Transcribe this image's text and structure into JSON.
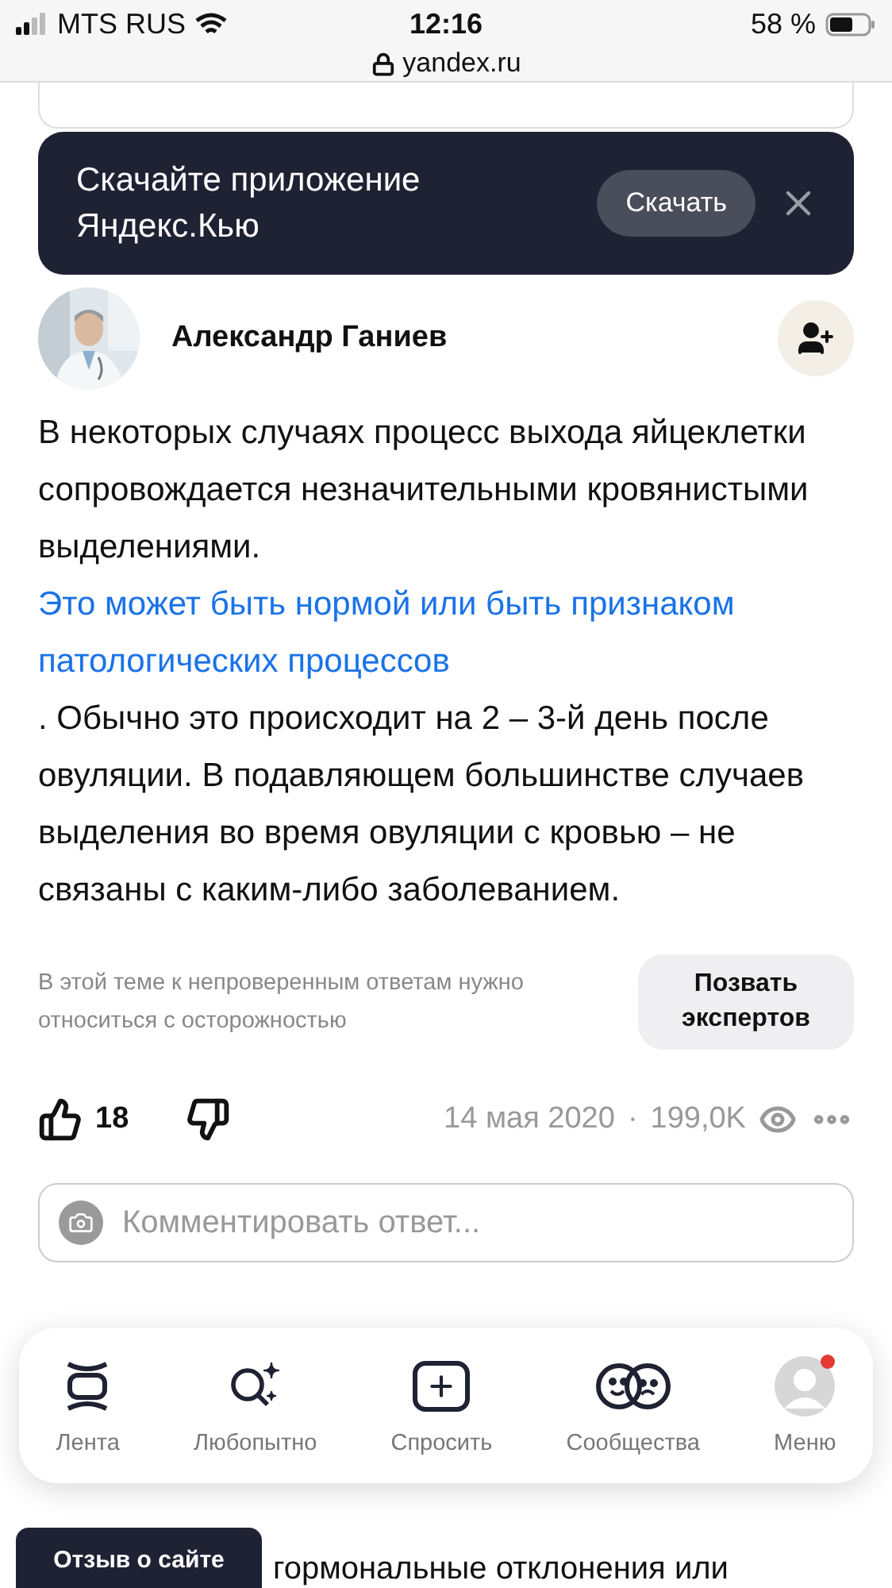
{
  "status_bar": {
    "carrier": "MTS RUS",
    "time": "12:16",
    "battery": "58 %",
    "url": "yandex.ru"
  },
  "banner": {
    "title": "Скачайте приложение Яндекс.Кью",
    "button": "Скачать"
  },
  "answer": {
    "author": "Александр Ганиев",
    "text_before": "В некоторых случаях процесс выхода яйцеклетки сопровождается незначительными кровянистыми выделениями. ",
    "link": "Это может быть нормой или быть признаком патологических процессов",
    "text_after": ". Обычно это происходит на 2 – 3-й день после овуляции. В подавляющем большинстве случаев выделения во время овуляции с кровью – не связаны с каким-либо заболеванием.",
    "note": "В этой теме к непроверенным ответам нужно относиться с осторожностью",
    "expert_button": "Позвать экспертов",
    "likes": "18",
    "date": "14 мая 2020",
    "separator": "·",
    "views": "199,0K",
    "comment_placeholder": "Комментировать ответ..."
  },
  "bottom_nav": [
    {
      "kind": "feed",
      "label": "Лента",
      "notification": false
    },
    {
      "kind": "explore",
      "label": "Любопытно",
      "notification": false
    },
    {
      "kind": "ask",
      "label": "Спросить",
      "notification": false
    },
    {
      "kind": "communities",
      "label": "Сообщества",
      "notification": false
    },
    {
      "kind": "menu",
      "label": "Меню",
      "notification": true
    }
  ],
  "feedback_button": "Отзыв о сайте",
  "next_answer": {
    "text": "гормональные отклонения или"
  }
}
